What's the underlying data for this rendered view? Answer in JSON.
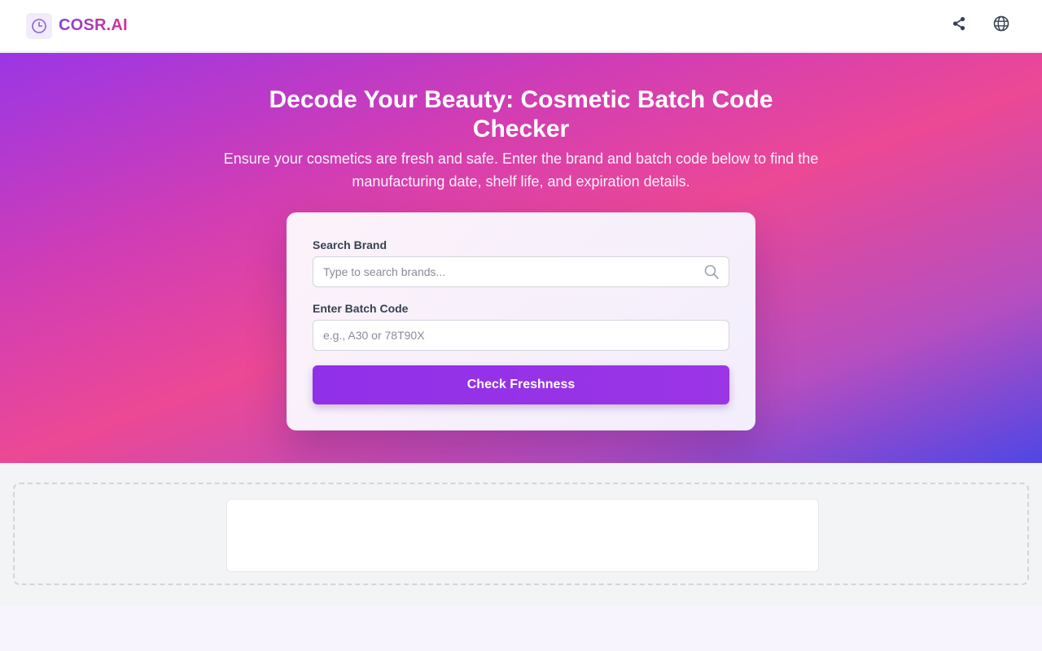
{
  "header": {
    "brand_name": "COSR.AI",
    "logo_icon": "clock-icon",
    "actions": [
      {
        "icon": "share-icon"
      },
      {
        "icon": "globe-icon"
      }
    ]
  },
  "hero": {
    "title": "Decode Your Beauty: Cosmetic Batch Code Checker",
    "subtitle": "Ensure your cosmetics are fresh and safe. Enter the brand and batch code below to find the manufacturing date, shelf life, and expiration details."
  },
  "form": {
    "brand_label": "Search Brand",
    "brand_placeholder": "Type to search brands...",
    "brand_value": "",
    "batch_label": "Enter Batch Code",
    "batch_placeholder": "e.g., A30 or 78T90X",
    "batch_value": "",
    "submit_label": "Check Freshness"
  },
  "colors": {
    "accent": "#9333ea",
    "brand_gradient_start": "#8b3fd9",
    "brand_gradient_end": "#d4338f"
  }
}
